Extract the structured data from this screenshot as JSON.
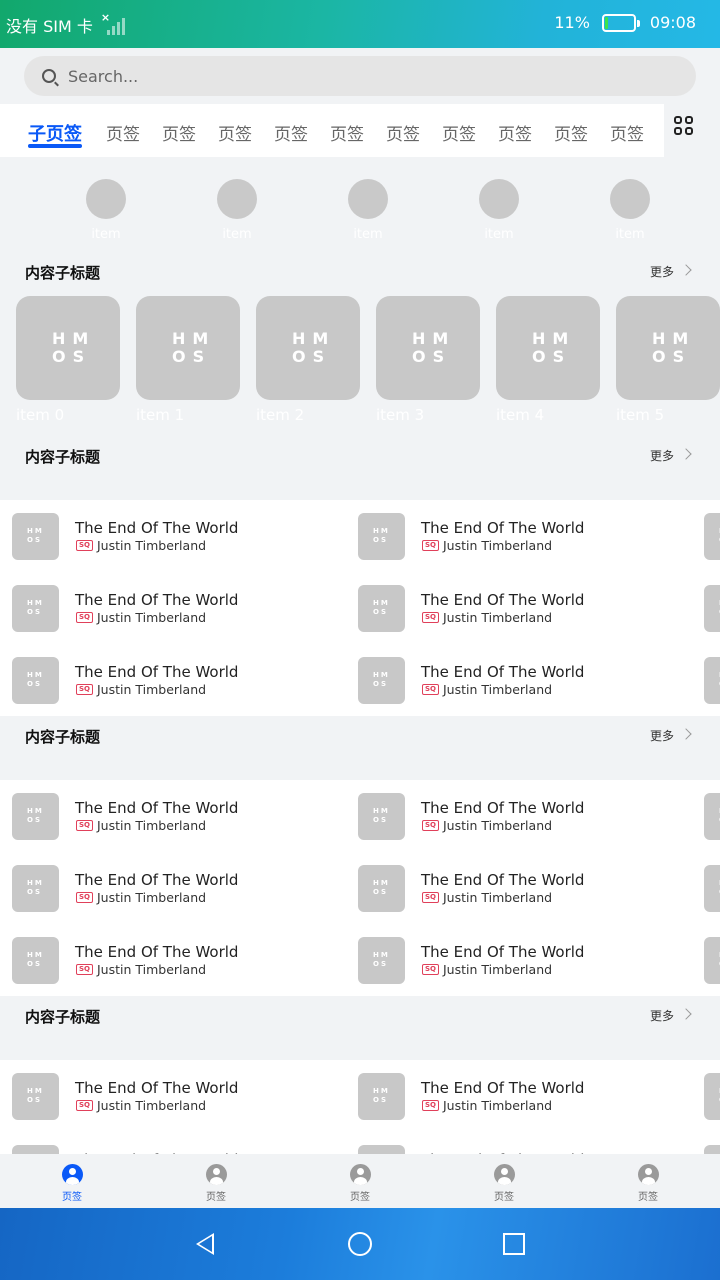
{
  "status_bar": {
    "carrier": "没有 SIM 卡",
    "signal_mark": "×",
    "battery_percent": "11%",
    "battery_level": 0.11,
    "time": "09:08"
  },
  "search": {
    "placeholder": "Search..."
  },
  "tabs": {
    "items": [
      "子页签",
      "页签",
      "页签",
      "页签",
      "页签",
      "页签",
      "页签",
      "页签",
      "页签",
      "页签",
      "页签"
    ],
    "active_index": 0,
    "grid_icon": "grid-icon"
  },
  "circle_items": [
    "item",
    "item",
    "item",
    "item",
    "item"
  ],
  "sections": [
    {
      "title": "内容子标题",
      "more": "更多"
    },
    {
      "title": "内容子标题",
      "more": "更多"
    },
    {
      "title": "内容子标题",
      "more": "更多"
    },
    {
      "title": "内容子标题",
      "more": "更多"
    }
  ],
  "cards": [
    "item 0",
    "item 1",
    "item 2",
    "item 3",
    "item 4",
    "item 5"
  ],
  "logo_text": "HMOS",
  "song": {
    "title": "The End Of The World",
    "artist": "Justin Timberland",
    "badge": "SQ"
  },
  "bottom_tabs": [
    "页签",
    "页签",
    "页签",
    "页签",
    "页签"
  ],
  "bottom_active_index": 0,
  "colors": {
    "accent": "#0a59f7",
    "placeholder_gray": "#c8c8c8",
    "badge_red": "#e0405a"
  }
}
